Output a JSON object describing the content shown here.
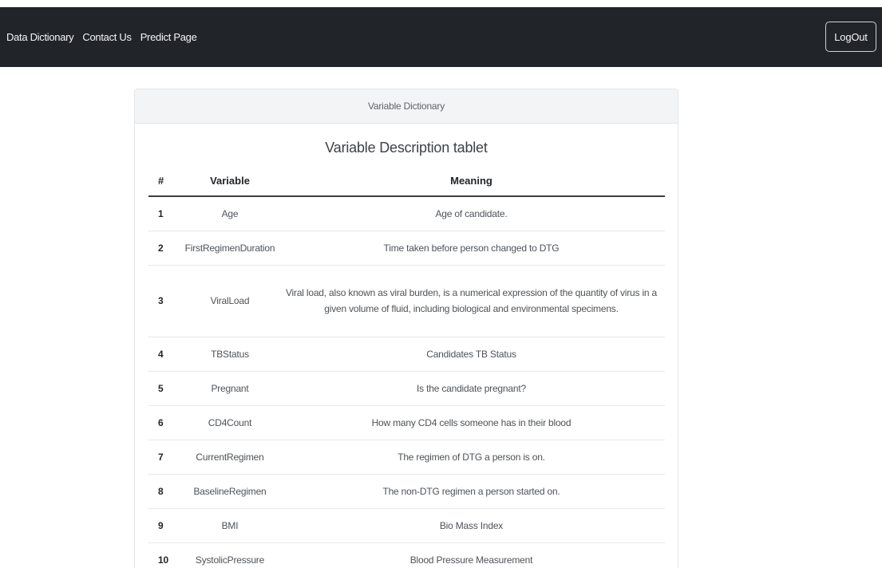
{
  "navbar": {
    "links": [
      "Data Dictionary",
      "Contact Us",
      "Predict Page"
    ],
    "logout_label": "LogOut"
  },
  "card": {
    "header": "Variable Dictionary",
    "title": "Variable Description tablet"
  },
  "table": {
    "headers": [
      "#",
      "Variable",
      "Meaning"
    ],
    "rows": [
      {
        "num": "1",
        "variable": "Age",
        "meaning": "Age of candidate."
      },
      {
        "num": "2",
        "variable": "FirstRegimenDuration",
        "meaning": "Time taken before person changed to DTG"
      },
      {
        "num": "3",
        "variable": "ViralLoad",
        "meaning": "Viral load, also known as viral burden, is a numerical expression of the quantity of virus in a given volume of fluid, including biological and environmental specimens."
      },
      {
        "num": "4",
        "variable": "TBStatus",
        "meaning": "Candidates TB Status"
      },
      {
        "num": "5",
        "variable": "Pregnant",
        "meaning": "Is the candidate pregnant?"
      },
      {
        "num": "6",
        "variable": "CD4Count",
        "meaning": "How many CD4 cells someone has in their blood"
      },
      {
        "num": "7",
        "variable": "CurrentRegimen",
        "meaning": "The regimen of DTG a person is on."
      },
      {
        "num": "8",
        "variable": "BaselineRegimen",
        "meaning": "The non-DTG regimen a person started on."
      },
      {
        "num": "9",
        "variable": "BMI",
        "meaning": "Bio Mass Index"
      },
      {
        "num": "10",
        "variable": "SystolicPressure",
        "meaning": "Blood Pressure Measurement"
      }
    ]
  },
  "colors": {
    "navbar_bg": "#212529",
    "card_header_bg": "#f3f4f6",
    "page_bg": "#ffffff"
  }
}
